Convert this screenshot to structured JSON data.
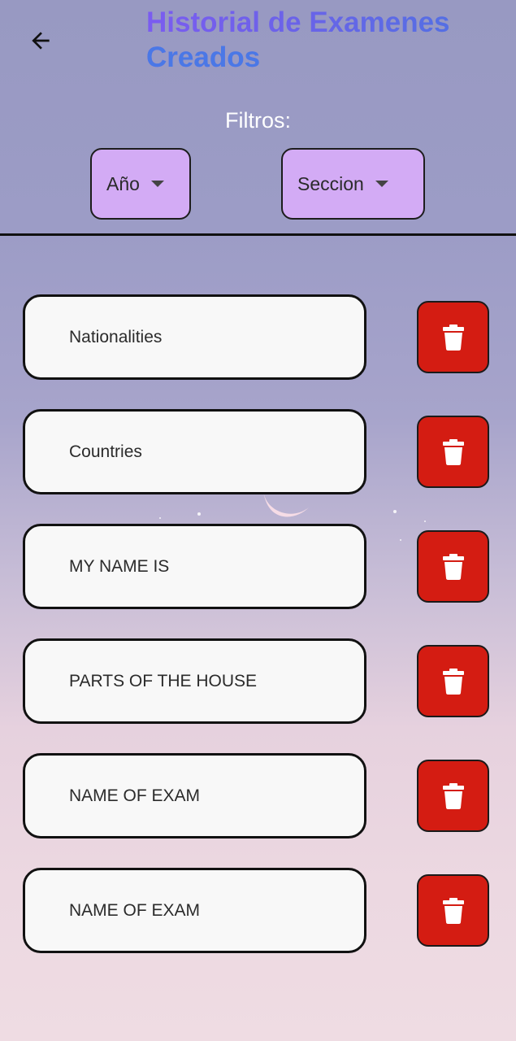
{
  "header": {
    "back_icon": "arrow-left-icon",
    "title_line1": "Historial de Examenes",
    "title_line2": "Creados",
    "title_colors": [
      "#7b5cf0",
      "#4a78e6"
    ]
  },
  "filters": {
    "label": "Filtros:",
    "year_label": "Año",
    "section_label": "Seccion",
    "dropdown_color": "#d3abf5"
  },
  "exams": [
    {
      "name": "Nationalities"
    },
    {
      "name": "Countries"
    },
    {
      "name": "MY NAME IS"
    },
    {
      "name": "PARTS OF THE HOUSE"
    },
    {
      "name": "NAME OF EXAM"
    },
    {
      "name": "NAME OF EXAM"
    }
  ],
  "delete_button": {
    "icon": "trash-icon",
    "color": "#d41c12"
  }
}
